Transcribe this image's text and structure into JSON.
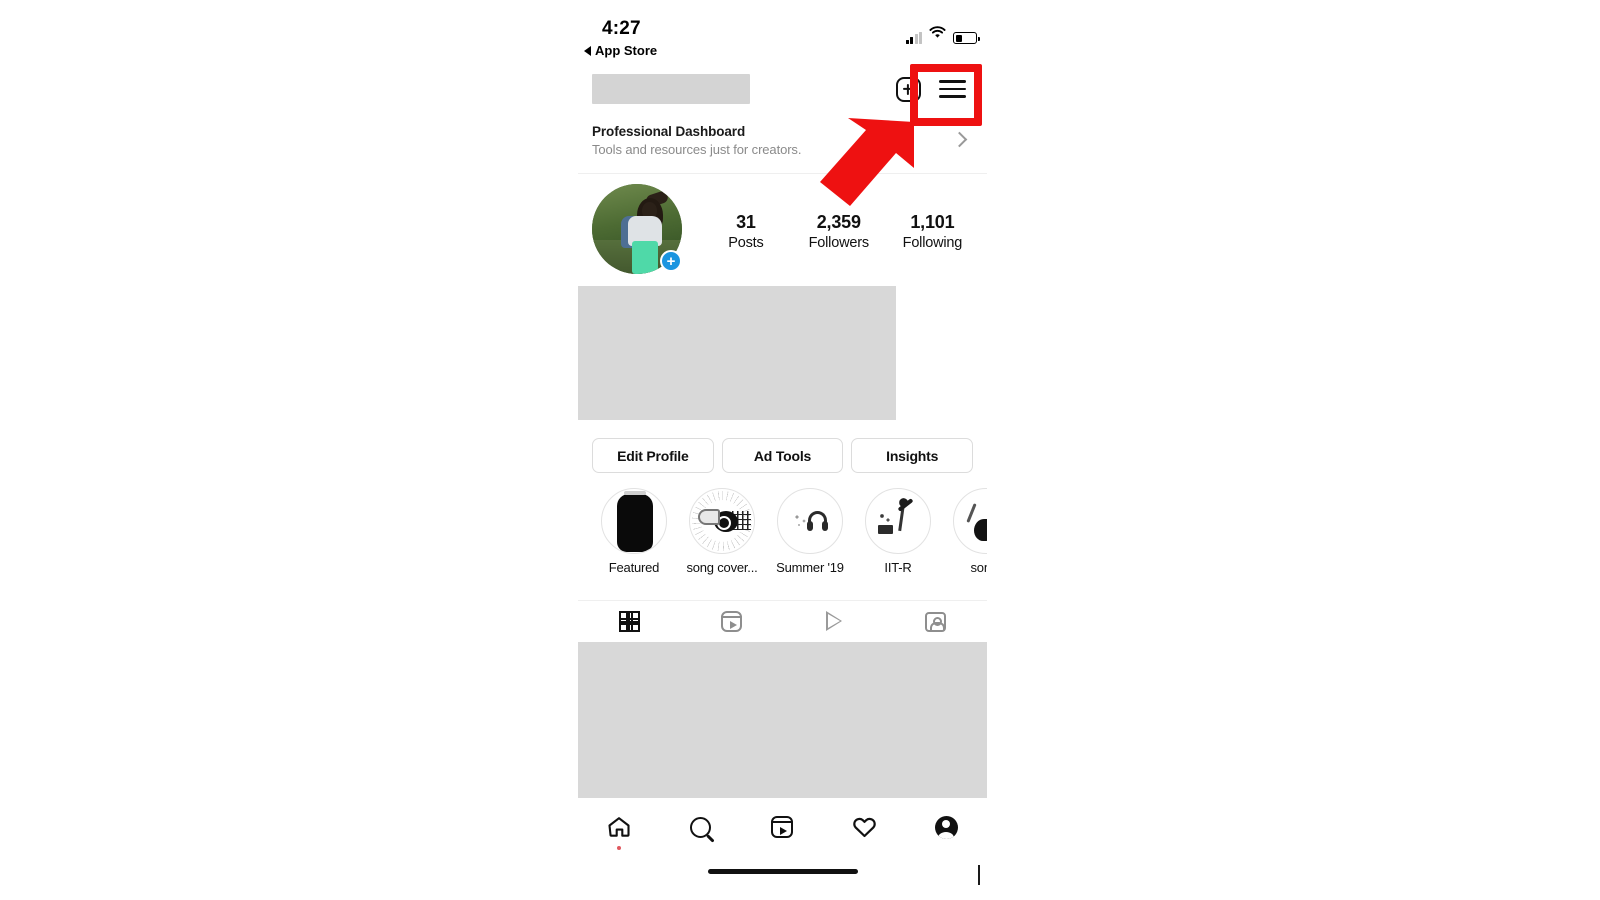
{
  "status_bar": {
    "time": "4:27",
    "back_label": "App Store",
    "signal_icon": "cellular-signal-icon",
    "wifi_icon": "wifi-icon",
    "battery_icon": "battery-icon"
  },
  "app_bar": {
    "username_redacted": "",
    "add_post_icon": "plus-square-icon",
    "menu_icon": "hamburger-menu-icon"
  },
  "annotation": {
    "highlight_target": "hamburger-menu-icon",
    "highlight_color": "#ee1111",
    "arrow_color": "#ee1111",
    "arrow_direction": "up-right"
  },
  "professional_dashboard": {
    "title": "Professional Dashboard",
    "subtitle": "Tools and resources just for creators.",
    "chevron_icon": "chevron-right-icon"
  },
  "profile": {
    "avatar_alt": "profile-photo",
    "add_story_badge": "+",
    "stats": [
      {
        "number": "31",
        "label": "Posts"
      },
      {
        "number": "2,359",
        "label": "Followers"
      },
      {
        "number": "1,101",
        "label": "Following"
      }
    ],
    "bio_redacted": ""
  },
  "action_buttons": [
    {
      "label": "Edit Profile"
    },
    {
      "label": "Ad Tools"
    },
    {
      "label": "Insights"
    }
  ],
  "highlights": [
    {
      "label": "Featured",
      "cover": "black-phone-cover"
    },
    {
      "label": "song cover...",
      "cover": "guitar-hand-cover"
    },
    {
      "label": "Summer '19",
      "cover": "headphones-cover"
    },
    {
      "label": "IIT-R",
      "cover": "person-sparkle-cover"
    },
    {
      "label": "some ",
      "cover": "blob-cover"
    }
  ],
  "content_tabs": [
    {
      "name": "grid-tab",
      "icon": "grid-icon",
      "active": true
    },
    {
      "name": "reels-tab",
      "icon": "reels-icon",
      "active": false
    },
    {
      "name": "igtv-tab",
      "icon": "play-triangle-icon",
      "active": false
    },
    {
      "name": "tagged-tab",
      "icon": "tagged-person-icon",
      "active": false
    }
  ],
  "bottom_nav": [
    {
      "name": "home",
      "icon": "home-icon",
      "badge": true
    },
    {
      "name": "search",
      "icon": "search-icon",
      "badge": false
    },
    {
      "name": "reels",
      "icon": "reels-icon",
      "badge": false
    },
    {
      "name": "activity",
      "icon": "heart-icon",
      "badge": false
    },
    {
      "name": "profile",
      "icon": "profile-avatar-icon",
      "badge": false
    }
  ]
}
